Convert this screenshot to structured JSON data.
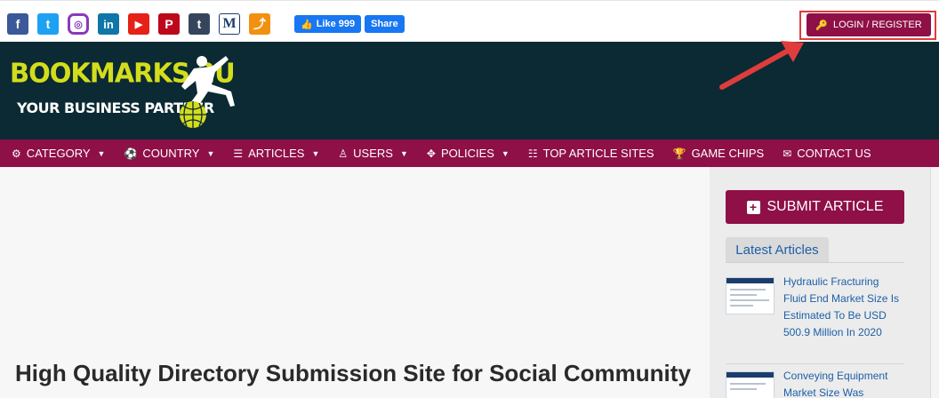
{
  "topbar": {
    "social_icons": [
      {
        "name": "facebook-icon",
        "glyph": "f",
        "color": "#3b5998"
      },
      {
        "name": "twitter-icon",
        "glyph": "t",
        "color": "#1da1f2"
      },
      {
        "name": "instagram-icon",
        "glyph": "◎",
        "color": "#8a3ab9"
      },
      {
        "name": "linkedin-icon",
        "glyph": "in",
        "color": "#0e76a8"
      },
      {
        "name": "youtube-icon",
        "glyph": "▶",
        "color": "#e62117"
      },
      {
        "name": "pinterest-icon",
        "glyph": "P",
        "color": "#bd081c"
      },
      {
        "name": "tumblr-icon",
        "glyph": "t",
        "color": "#35465c"
      },
      {
        "name": "medium-icon",
        "glyph": "M",
        "color": "#ffffff"
      },
      {
        "name": "share-icon",
        "glyph": "⤴",
        "color": "#f29111"
      }
    ],
    "like_label": "Like 999",
    "share_label": "Share",
    "login_label": "LOGIN / REGISTER"
  },
  "header": {
    "logo_title": "BOOKMARKS 2U",
    "logo_subtitle": "YOUR BUSINESS PARTNER"
  },
  "nav": {
    "items": [
      {
        "label": "CATEGORY",
        "icon": "⚙",
        "dropdown": "true"
      },
      {
        "label": "COUNTRY",
        "icon": "⚽",
        "dropdown": "true"
      },
      {
        "label": "ARTICLES",
        "icon": "☰",
        "dropdown": "true"
      },
      {
        "label": "USERS",
        "icon": "♙",
        "dropdown": "true"
      },
      {
        "label": "POLICIES",
        "icon": "✥",
        "dropdown": "true"
      },
      {
        "label": "TOP ARTICLE SITES",
        "icon": "☷",
        "dropdown": "false"
      },
      {
        "label": "GAME CHIPS",
        "icon": "🏆",
        "dropdown": "false"
      },
      {
        "label": "CONTACT US",
        "icon": "✉",
        "dropdown": "false"
      }
    ]
  },
  "main": {
    "heading": "High Quality Directory Submission Site for Social Community"
  },
  "sidebar": {
    "submit_label": "SUBMIT ARTICLE",
    "latest_label": "Latest Articles",
    "articles": [
      {
        "title": "Hydraulic Fracturing Fluid End Market Size Is Estimated To Be USD 500.9 Million In 2020"
      },
      {
        "title": "Conveying Equipment Market Size Was"
      }
    ]
  },
  "colors": {
    "brand": "#8e1047",
    "header_bg": "#0b2a33",
    "logo_yellow": "#d4dd1c",
    "link_blue": "#1d5fa7",
    "annotation_red": "#e03c3c"
  }
}
